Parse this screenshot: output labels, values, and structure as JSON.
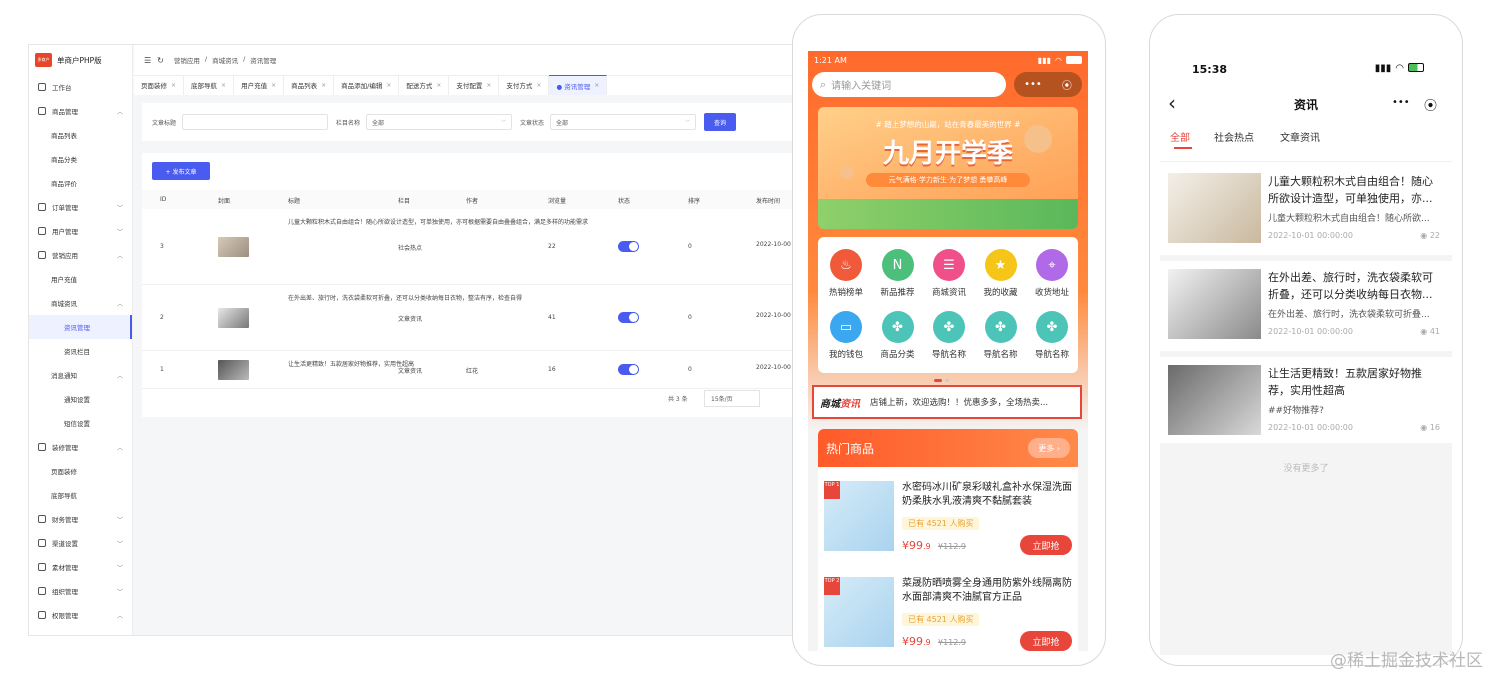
{
  "admin": {
    "logo_text": "单商户PHP版",
    "logo_badge": "多商户",
    "sidebar": [
      {
        "label": "工作台",
        "level": 0
      },
      {
        "label": "商品管理",
        "level": 0,
        "chev": "︿"
      },
      {
        "label": "商品列表",
        "level": 1
      },
      {
        "label": "商品分类",
        "level": 1
      },
      {
        "label": "商品评价",
        "level": 1
      },
      {
        "label": "订单管理",
        "level": 0,
        "chev": "﹀"
      },
      {
        "label": "用户管理",
        "level": 0,
        "chev": "﹀"
      },
      {
        "label": "营销应用",
        "level": 0,
        "chev": "︿"
      },
      {
        "label": "用户充值",
        "level": 1
      },
      {
        "label": "商城资讯",
        "level": 1,
        "chev": "︿"
      },
      {
        "label": "资讯管理",
        "level": 2,
        "active": true
      },
      {
        "label": "资讯栏目",
        "level": 2
      },
      {
        "label": "消息通知",
        "level": 1,
        "chev": "︿"
      },
      {
        "label": "通知设置",
        "level": 2
      },
      {
        "label": "短信设置",
        "level": 2
      },
      {
        "label": "装修管理",
        "level": 0,
        "chev": "︿"
      },
      {
        "label": "页面装修",
        "level": 1
      },
      {
        "label": "底部导航",
        "level": 1
      },
      {
        "label": "财务管理",
        "level": 0,
        "chev": "﹀"
      },
      {
        "label": "渠道设置",
        "level": 0,
        "chev": "﹀"
      },
      {
        "label": "素材管理",
        "level": 0,
        "chev": "﹀"
      },
      {
        "label": "组织管理",
        "level": 0,
        "chev": "﹀"
      },
      {
        "label": "权限管理",
        "level": 0,
        "chev": "︿"
      }
    ],
    "breadcrumb": [
      "营销应用",
      "/",
      "商城资讯",
      "/",
      "资讯管理"
    ],
    "topbar_icons": [
      "☰",
      "↻"
    ],
    "tabs": [
      {
        "label": "页面装修"
      },
      {
        "label": "底部导航"
      },
      {
        "label": "用户充值"
      },
      {
        "label": "商品列表"
      },
      {
        "label": "商品添加/编辑"
      },
      {
        "label": "配送方式"
      },
      {
        "label": "支付配置"
      },
      {
        "label": "支付方式"
      },
      {
        "label": "● 资讯管理",
        "active": true
      }
    ],
    "tab_close": "×",
    "filter": {
      "title_label": "文章标题",
      "title_value": "",
      "column_label": "栏目名称",
      "column_value": "全部",
      "status_label": "文章状态",
      "status_value": "全部",
      "query_button": "查询"
    },
    "publish_button": "+ 发布文章",
    "columns": [
      "ID",
      "封面",
      "标题",
      "栏目",
      "作者",
      "浏览量",
      "状态",
      "排序",
      "发布时间"
    ],
    "rows": [
      {
        "id": "3",
        "title": "儿童大颗粒积木式自由组合！随心所欲设计造型，可单独使用，亦可根据需要自由叠叠组合，满足多样的功能需求",
        "column": "社会热点",
        "author": "",
        "views": "22",
        "sort": "0",
        "time": "2022-10-00",
        "status_on": true
      },
      {
        "id": "2",
        "title": "在外出差、旅行时，洗衣袋柔软可折叠，还可以分类收纳每日衣物，整洁有序，检查自得",
        "column": "文章资讯",
        "author": "",
        "views": "41",
        "sort": "0",
        "time": "2022-10-00",
        "status_on": true
      },
      {
        "id": "1",
        "title": "让生活更精致！五款居家好物推荐，实用性超高",
        "column": "文章资讯",
        "author": "红花",
        "views": "16",
        "sort": "0",
        "time": "2022-10-00",
        "status_on": true
      }
    ],
    "pager": {
      "total": "共 3 条",
      "size": "15条/页"
    }
  },
  "phone1": {
    "time": "1:21 AM",
    "search_placeholder": "请输入关键词",
    "capsule_dots": "•••",
    "capsule_target": "⦿",
    "banner": {
      "top_text": "# 踏上梦想的山巅，站在青春最美的世界 #",
      "title": "九月开学季",
      "subtitle": "元气满格·学力新生·为了梦想 勇攀高峰"
    },
    "icons": [
      {
        "label": "热销榜单",
        "color": "#f05a3a",
        "glyph": "♨"
      },
      {
        "label": "新品推荐",
        "color": "#4cc07a",
        "glyph": "N"
      },
      {
        "label": "商城资讯",
        "color": "#f0508a",
        "glyph": "☰"
      },
      {
        "label": "我的收藏",
        "color": "#f5c518",
        "glyph": "★"
      },
      {
        "label": "收货地址",
        "color": "#b06ae8",
        "glyph": "⌖"
      },
      {
        "label": "我的钱包",
        "color": "#3aa7f0",
        "glyph": "▭"
      },
      {
        "label": "商品分类",
        "color": "#4cc5b8",
        "glyph": "✤"
      },
      {
        "label": "导航名称",
        "color": "#4cc5b8",
        "glyph": "✤"
      },
      {
        "label": "导航名称",
        "color": "#4cc5b8",
        "glyph": "✤"
      },
      {
        "label": "导航名称",
        "color": "#4cc5b8",
        "glyph": "✤"
      }
    ],
    "news": {
      "brand_a": "商城",
      "brand_b": "资讯",
      "text": "店铺上新，欢迎选购！！优惠多多，全场热卖..."
    },
    "hot": {
      "title": "热门商品",
      "more": "更多 ›"
    },
    "products": [
      {
        "top": "TOP 1",
        "title": "水密码冰川矿泉彩啵礼盒补水保湿洗面奶柔肤水乳液清爽不黏腻套装",
        "sold": "已有 4521 人购买",
        "price": "99",
        "price_dec": ".9",
        "old": "¥112.9",
        "buy": "立即抢"
      },
      {
        "top": "TOP 2",
        "title": "菜晟防晒喷雾全身通用防紫外线隔离防水面部清爽不油腻官方正品",
        "sold": "已有 4521 人购买",
        "price": "99",
        "price_dec": ".9",
        "old": "¥112.9",
        "buy": "立即抢"
      }
    ]
  },
  "phone2": {
    "time": "15:38",
    "title": "资讯",
    "back": "‹",
    "capsule_dots": "•••",
    "capsule_target": "⦿",
    "tabs": [
      "全部",
      "社会热点",
      "文章资讯"
    ],
    "articles": [
      {
        "title": "儿童大颗粒积木式自由组合！随心所欲设计造型，可单独使用，亦...",
        "desc": "儿童大颗粒积木式自由组合！随心所欲...",
        "time": "2022-10-01 00:00:00",
        "views": "22"
      },
      {
        "title": "在外出差、旅行时，洗衣袋柔软可折叠，还可以分类收纳每日衣物...",
        "desc": "在外出差、旅行时，洗衣袋柔软可折叠...",
        "time": "2022-10-01 00:00:00",
        "views": "41"
      },
      {
        "title": "让生活更精致！五款居家好物推荐，实用性超高",
        "desc": "##好物推荐?",
        "time": "2022-10-01 00:00:00",
        "views": "16"
      }
    ],
    "no_more": "没有更多了"
  },
  "watermark": "@稀土掘金技术社区"
}
